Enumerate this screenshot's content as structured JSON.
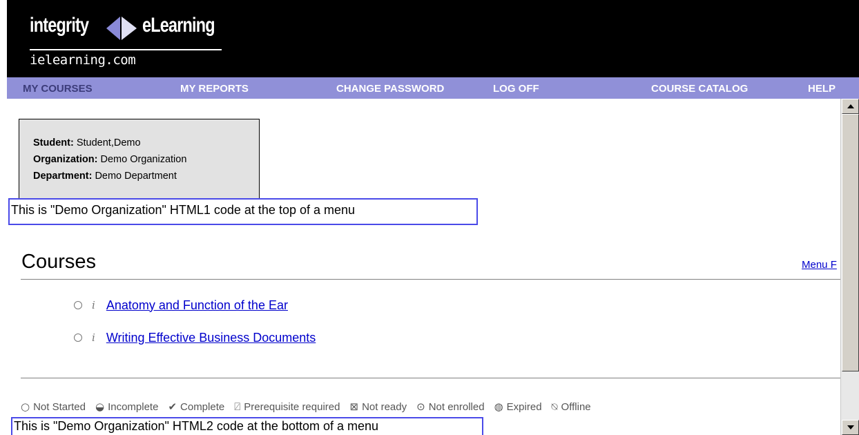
{
  "logo": {
    "word_left": "integrity",
    "word_right": "eLearning",
    "domain": "ielearning.com"
  },
  "nav": {
    "my_courses": "MY COURSES",
    "my_reports": "MY REPORTS",
    "change_password": "CHANGE PASSWORD",
    "log_off": "LOG OFF",
    "course_catalog": "COURSE CATALOG",
    "help": "HELP"
  },
  "student": {
    "student_label": "Student:",
    "student_value": "Student,Demo",
    "organization_label": "Organization:",
    "organization_value": "Demo Organization",
    "department_label": "Department:",
    "department_value": "Demo Department"
  },
  "html1_text": "This is \"Demo Organization\" HTML1 code at the top of a menu",
  "courses": {
    "title": "Courses",
    "menu_link": "Menu F",
    "items": [
      {
        "info": "i",
        "title": "Anatomy and Function of the Ear"
      },
      {
        "info": "i",
        "title": "Writing Effective Business Documents"
      }
    ]
  },
  "legend": [
    {
      "symbol": "○",
      "label": "Not Started"
    },
    {
      "symbol": "◒",
      "label": "Incomplete"
    },
    {
      "symbol": "✔",
      "label": "Complete"
    },
    {
      "symbol": "⍁",
      "label": "Prerequisite required"
    },
    {
      "symbol": "⊠",
      "label": "Not ready"
    },
    {
      "symbol": "⊙",
      "label": "Not enrolled"
    },
    {
      "symbol": "◍",
      "label": "Expired"
    },
    {
      "symbol": "⍉",
      "label": "Offline"
    }
  ],
  "html2_text": "This is \"Demo Organization\" HTML2 code at the bottom of a menu",
  "colors": {
    "header_bg": "#000000",
    "nav_bg": "#9090d8",
    "nav_active": "#3c3c7a",
    "link": "#0000cc",
    "html_box_border": "#4a4ae8",
    "student_box_bg": "#e2e2e2"
  }
}
